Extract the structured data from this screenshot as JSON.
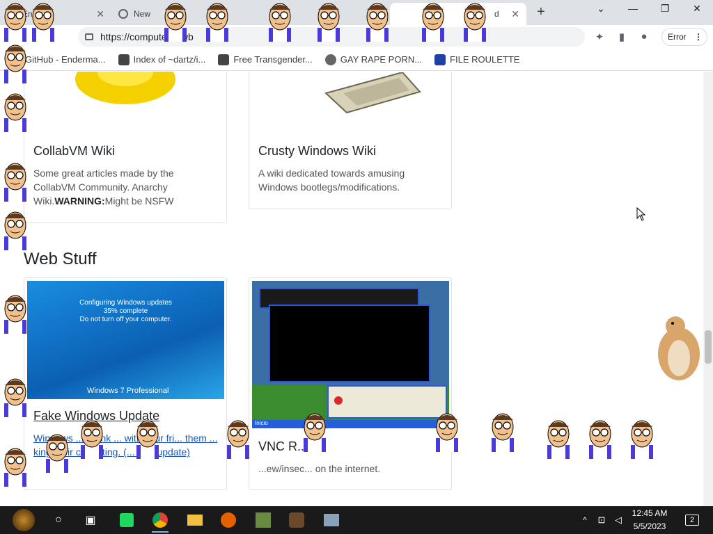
{
  "browser": {
    "tabs": [
      {
        "label": "Ender"
      },
      {
        "label": "New"
      },
      {
        "label": "d"
      }
    ],
    "address": "https://computernewb",
    "error_label": "Error",
    "bookmarks": [
      {
        "label": "GitHub - Enderma..."
      },
      {
        "label": "Index of ~dartz/i..."
      },
      {
        "label": "Free Transgender..."
      },
      {
        "label": "GAY RAPE PORN..."
      },
      {
        "label": "FILE ROULETTE"
      }
    ]
  },
  "page": {
    "cards_top": [
      {
        "title": "CollabVM Wiki",
        "text_parts": [
          "Some great articles made by the CollabVM Community. Anarchy Wiki.",
          "WARNING:",
          "Might be NSFW"
        ]
      },
      {
        "title": "Crusty Windows Wiki",
        "text": "A wiki dedicated towards amusing Windows bootlegs/modifications."
      }
    ],
    "section_title": "Web Stuff",
    "cards_web": [
      {
        "title": "Fake Windows Update",
        "text": "Windows ... prank ... with your fri... them ... king their co... ating. (... r an update)",
        "shot_lines": [
          "Configuring Windows updates",
          "35% complete",
          "Do not turn off your computer."
        ],
        "shot_brand": "Windows 7 Professional"
      },
      {
        "title": "VNC R...",
        "text": "...ew/insec... on the internet.",
        "shot_brand": "Inicio"
      }
    ]
  },
  "taskbar": {
    "time": "12:45 AM",
    "date": "5/5/2023",
    "notifications": "2"
  },
  "colors": {
    "tabstrip": "#dee1e6",
    "taskbar": "#1a1a1a",
    "link": "#212529"
  }
}
